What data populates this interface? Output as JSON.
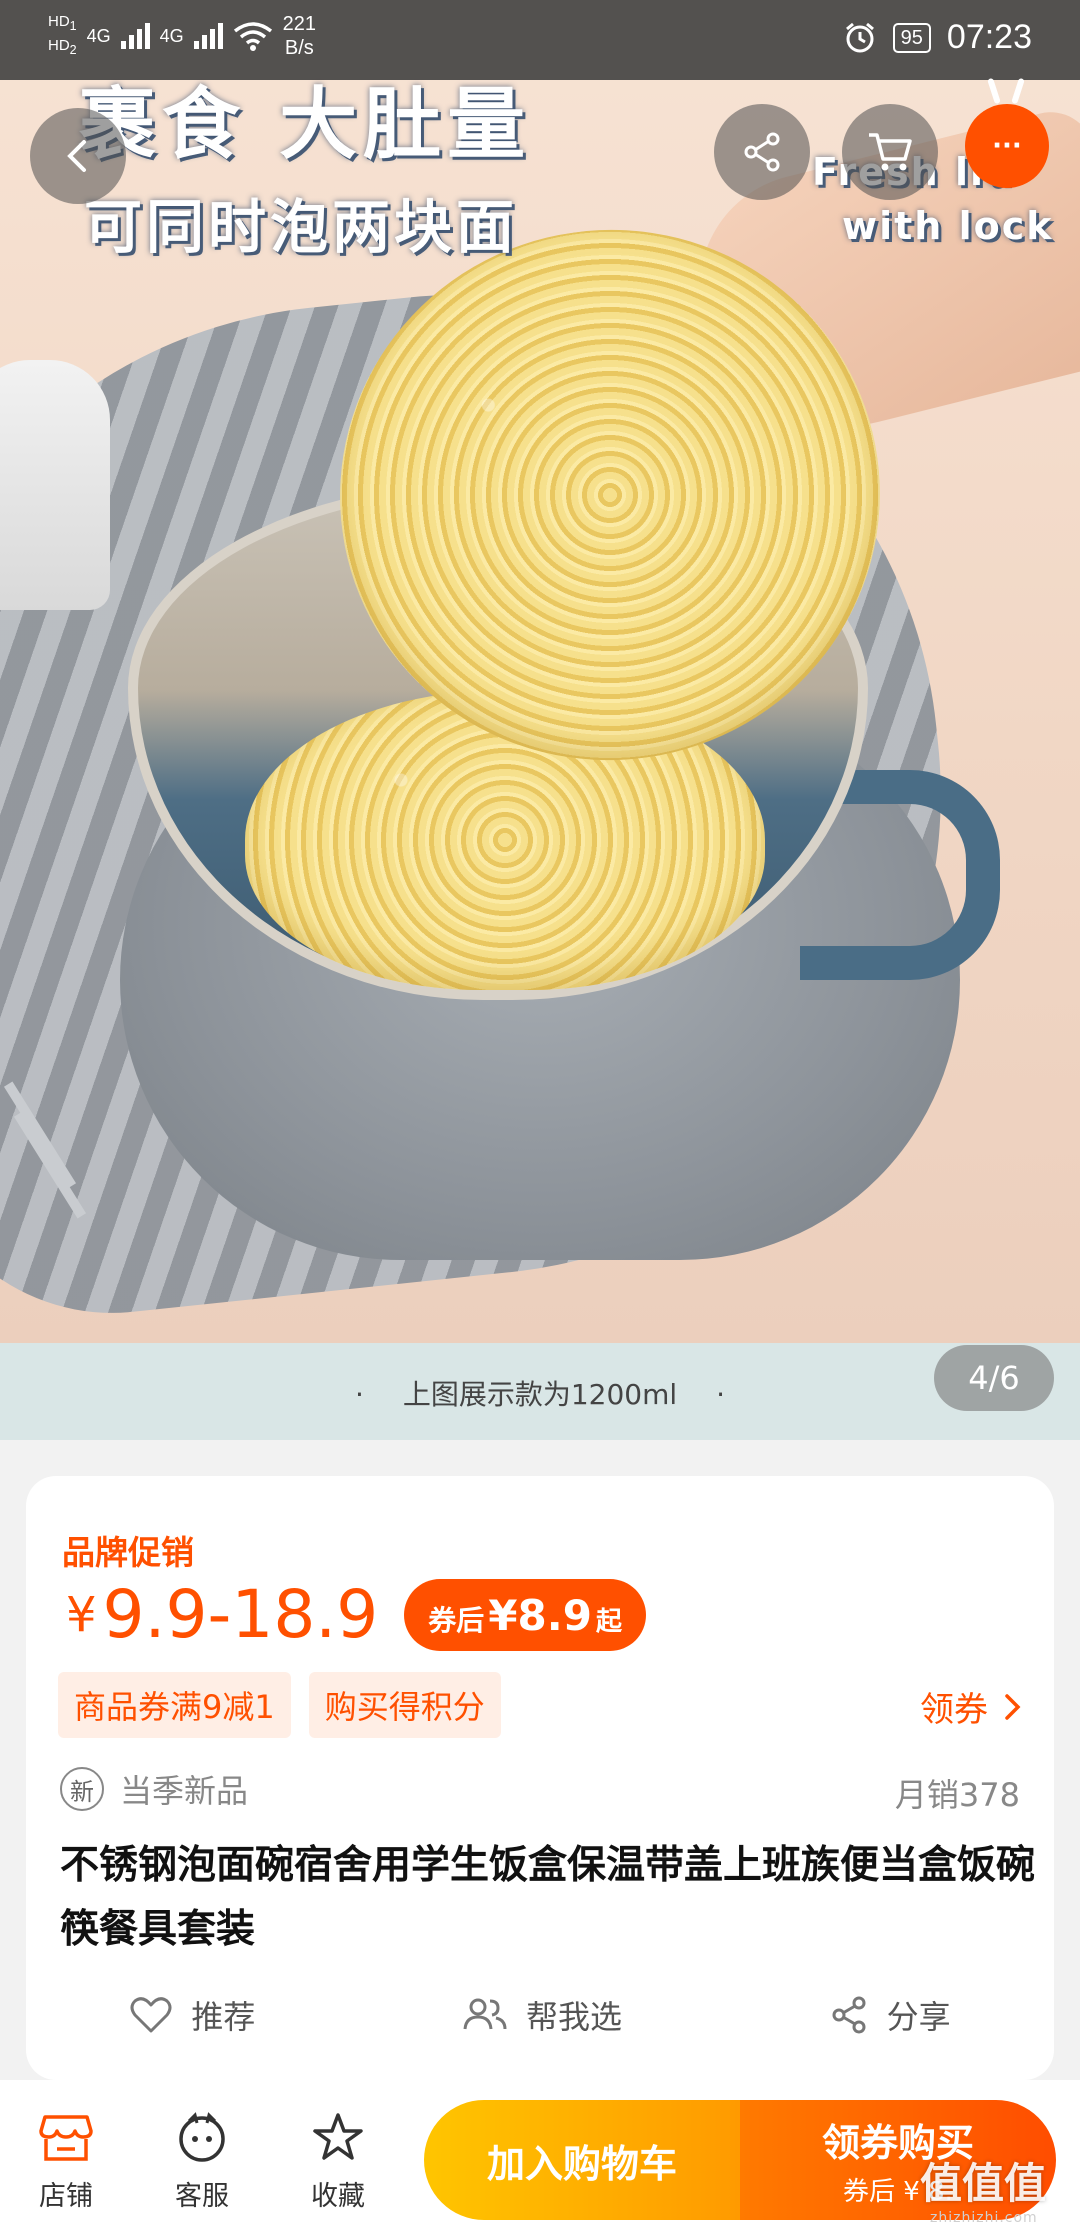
{
  "status_bar": {
    "hd1": "HD",
    "hd1_sub": "1",
    "hd2": "HD",
    "hd2_sub": "2",
    "net1": "4G",
    "net2": "4G",
    "speed_value": "221",
    "speed_unit": "B/s",
    "battery": "95",
    "time": "07:23"
  },
  "image_overlay": {
    "line1": "裹食 大肚量",
    "line2": "可同时泡两块面",
    "en_line1": "Fresh lid",
    "en_line2": "with lock"
  },
  "top_buttons": {
    "back_icon": "chevron-left",
    "share_icon": "share",
    "cart_icon": "cart",
    "more_label": "···"
  },
  "caption": {
    "text": "上图展示款为1200ml",
    "dot": "·"
  },
  "pager": {
    "label": "4/6"
  },
  "product": {
    "promo_label": "品牌促销",
    "currency": "¥",
    "price_range": "9.9-18.9",
    "coupon_prefix": "券后",
    "coupon_price": "¥8.9",
    "coupon_suffix": "起",
    "tags": [
      "商品券满9减1",
      "购买得积分"
    ],
    "get_coupon": "领券",
    "new_badge": "新",
    "new_text": "当季新品",
    "sales": "月销378",
    "title": "不锈钢泡面碗宿舍用学生饭盒保温带盖上班族便当盒饭碗筷餐具套装"
  },
  "actions": [
    {
      "label": "推荐",
      "icon": "heart-icon"
    },
    {
      "label": "帮我选",
      "icon": "people-icon"
    },
    {
      "label": "分享",
      "icon": "share-icon"
    }
  ],
  "bottom_nav": {
    "shop": "店铺",
    "service": "客服",
    "favorite": "收藏"
  },
  "buttons": {
    "add_to_cart": "加入购物车",
    "buy_line1": "领券购买",
    "buy_line2": "券后 ¥ 8."
  },
  "watermark": {
    "main": "值值值",
    "sub": "zhizhizhi.com"
  },
  "colors": {
    "accent": "#ff5000",
    "cart_button": "#ffb000",
    "caption_strip": "#d9e6e6"
  }
}
